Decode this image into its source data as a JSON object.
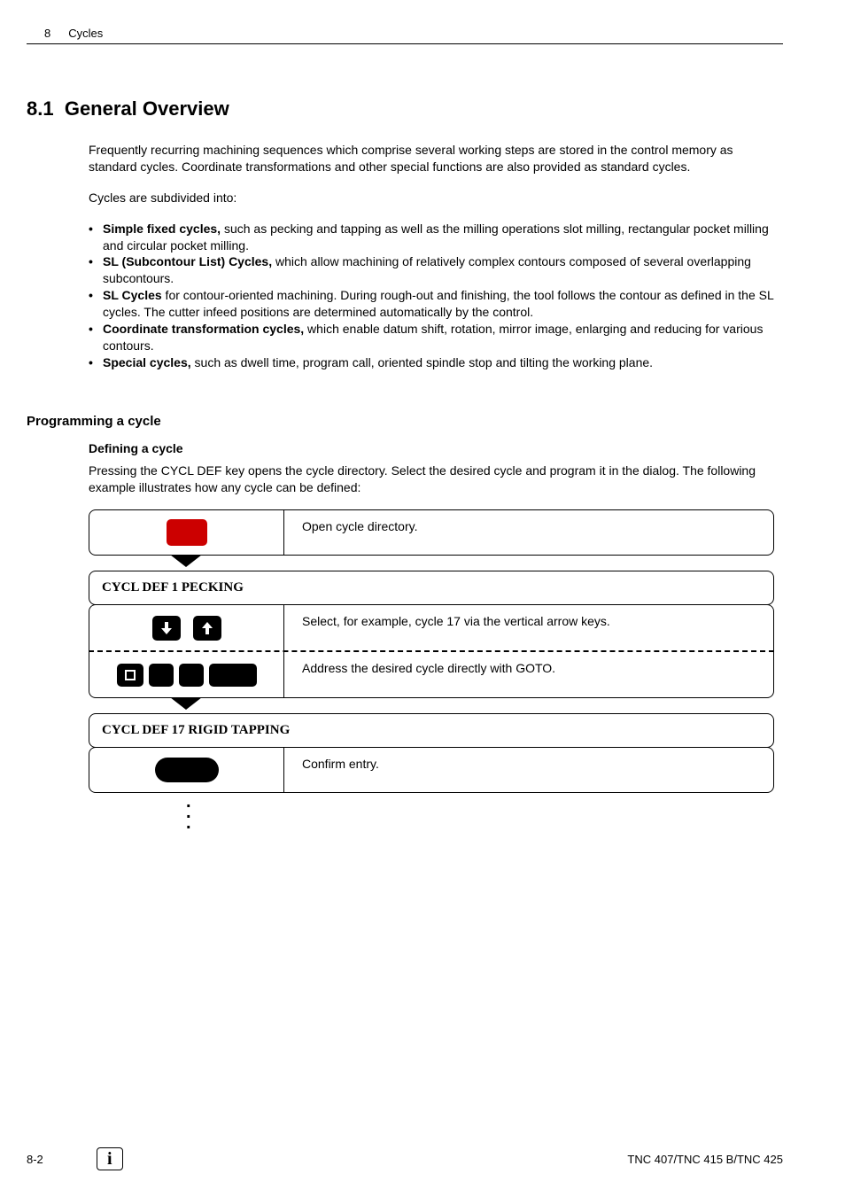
{
  "header": {
    "chapterNum": "8",
    "chapterTitle": "Cycles"
  },
  "section": {
    "number": "8.1",
    "title": "General Overview"
  },
  "intro": "Frequently recurring machining sequences which comprise several working steps are stored in the control memory as standard cycles. Coordinate transformations and other special functions are also provided as standard cycles.",
  "subIntro": "Cycles are subdivided into:",
  "bullets": [
    {
      "bold": "Simple fixed cycles,",
      "rest": " such as pecking and tapping as well as the milling operations slot milling, rectangular pocket milling and circular pocket milling."
    },
    {
      "bold": "SL (Subcontour List) Cycles,",
      "rest": " which allow machining of relatively complex contours composed of several overlapping subcontours."
    },
    {
      "bold": "SL Cycles",
      "rest": " for contour-oriented machining. During rough-out and finishing, the tool follows the contour as defined in the SL cycles. The cutter infeed positions are determined automatically by the control."
    },
    {
      "bold": "Coordinate transformation cycles,",
      "rest": " which enable datum shift, rotation, mirror image, enlarging and reducing for various contours."
    },
    {
      "bold": "Special cycles,",
      "rest": " such as dwell time, program call, oriented spindle stop and tilting the working plane."
    }
  ],
  "programming": {
    "heading": "Programming a cycle",
    "subheading": "Defining a cycle",
    "text": "Pressing the CYCL DEF key opens the cycle directory. Select the desired cycle and program it in the dialog. The following example illustrates how any cycle can be defined:"
  },
  "steps": {
    "step1": "Open cycle directory.",
    "mono1": "CYCL DEF 1 PECKING",
    "step2a": "Select, for example, cycle 17 via the vertical arrow keys.",
    "step2b": "Address the desired cycle directly with GOTO.",
    "mono2": "CYCL DEF 17 RIGID TAPPING",
    "step3": "Confirm entry."
  },
  "footer": {
    "pageNum": "8-2",
    "docRef": "TNC 407/TNC 415 B/TNC 425"
  }
}
